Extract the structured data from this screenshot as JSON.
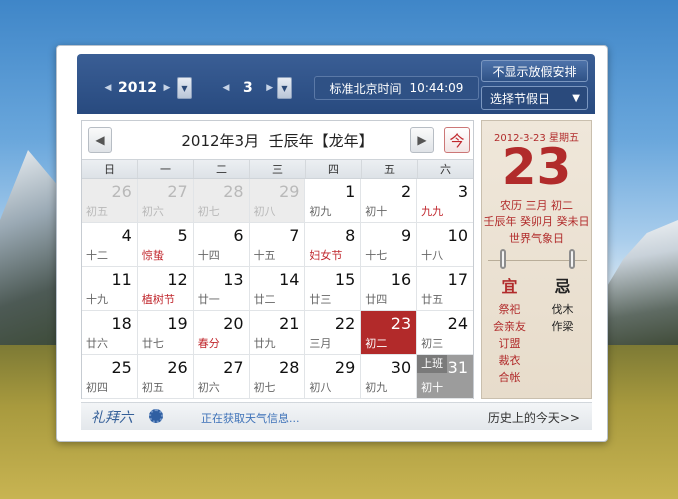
{
  "toolbar": {
    "year": "2012",
    "month": "3",
    "time_label": "标准北京时间",
    "time_value": "10:44:09",
    "holiday_toggle_label": "不显示放假安排",
    "holiday_select_label": "选择节假日"
  },
  "calendar": {
    "title": "2012年3月  壬辰年【龙年】",
    "today_button_label": "今",
    "weekdays": [
      "日",
      "一",
      "二",
      "三",
      "四",
      "五",
      "六"
    ],
    "rows": [
      [
        {
          "day": "26",
          "lunar": "初五",
          "state": "other"
        },
        {
          "day": "27",
          "lunar": "初六",
          "state": "other"
        },
        {
          "day": "28",
          "lunar": "初七",
          "state": "other"
        },
        {
          "day": "29",
          "lunar": "初八",
          "state": "other"
        },
        {
          "day": "1",
          "lunar": "初九",
          "state": "normal"
        },
        {
          "day": "2",
          "lunar": "初十",
          "state": "normal"
        },
        {
          "day": "3",
          "lunar": "九九",
          "state": "weekend",
          "festival": true
        }
      ],
      [
        {
          "day": "4",
          "lunar": "十二",
          "state": "weekend"
        },
        {
          "day": "5",
          "lunar": "惊蛰",
          "state": "normal",
          "festival": true
        },
        {
          "day": "6",
          "lunar": "十四",
          "state": "normal"
        },
        {
          "day": "7",
          "lunar": "十五",
          "state": "normal"
        },
        {
          "day": "8",
          "lunar": "妇女节",
          "state": "normal",
          "festival": true
        },
        {
          "day": "9",
          "lunar": "十七",
          "state": "normal"
        },
        {
          "day": "10",
          "lunar": "十八",
          "state": "weekend"
        }
      ],
      [
        {
          "day": "11",
          "lunar": "十九",
          "state": "weekend"
        },
        {
          "day": "12",
          "lunar": "植树节",
          "state": "normal",
          "festival": true
        },
        {
          "day": "13",
          "lunar": "廿一",
          "state": "normal"
        },
        {
          "day": "14",
          "lunar": "廿二",
          "state": "normal"
        },
        {
          "day": "15",
          "lunar": "廿三",
          "state": "normal"
        },
        {
          "day": "16",
          "lunar": "廿四",
          "state": "normal"
        },
        {
          "day": "17",
          "lunar": "廿五",
          "state": "weekend"
        }
      ],
      [
        {
          "day": "18",
          "lunar": "廿六",
          "state": "weekend"
        },
        {
          "day": "19",
          "lunar": "廿七",
          "state": "normal"
        },
        {
          "day": "20",
          "lunar": "春分",
          "state": "normal",
          "festival": true
        },
        {
          "day": "21",
          "lunar": "廿九",
          "state": "normal"
        },
        {
          "day": "22",
          "lunar": "三月",
          "state": "normal"
        },
        {
          "day": "23",
          "lunar": "初二",
          "state": "today"
        },
        {
          "day": "24",
          "lunar": "初三",
          "state": "weekend"
        }
      ],
      [
        {
          "day": "25",
          "lunar": "初四",
          "state": "weekend"
        },
        {
          "day": "26",
          "lunar": "初五",
          "state": "normal"
        },
        {
          "day": "27",
          "lunar": "初六",
          "state": "normal"
        },
        {
          "day": "28",
          "lunar": "初七",
          "state": "normal"
        },
        {
          "day": "29",
          "lunar": "初八",
          "state": "normal"
        },
        {
          "day": "30",
          "lunar": "初九",
          "state": "normal"
        },
        {
          "day": "31",
          "lunar": "初十",
          "state": "shift",
          "badge": "上班"
        }
      ]
    ]
  },
  "detail": {
    "date_line": "2012-3-23 星期五",
    "big_day": "23",
    "lunar_line": "农历 三月 初二",
    "ganzhi_line": "壬辰年 癸卯月 癸未日",
    "weather_line": "世界气象日",
    "yi_label": "宜",
    "ji_label": "忌",
    "yi_items": [
      "祭祀",
      "会亲友",
      "订盟",
      "裁衣",
      "合帐"
    ],
    "ji_items": [
      "伐木",
      "作梁"
    ]
  },
  "footer": {
    "logo_text": "礼拜六",
    "weather_status": "正在获取天气信息...",
    "history_link": "历史上的今天>>"
  },
  "colors": {
    "accent_red": "#b22a2a",
    "toolbar_blue": "#284a7f",
    "weekend_blue": "#1d4ea0"
  }
}
